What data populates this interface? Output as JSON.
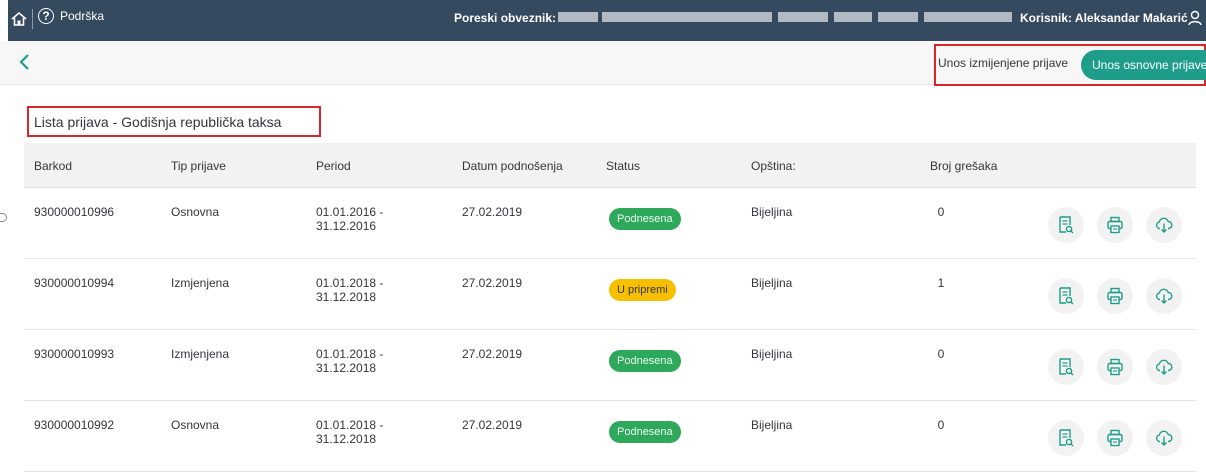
{
  "shell": {
    "help_label": "Podrška",
    "taxpayer_label": "Poreski obveznik:",
    "user_label": "Korisnik: Aleksandar Makarić"
  },
  "toolbar": {
    "amend_label": "Unos izmijenjene prijave",
    "basic_label": "Unos osnovne prijave"
  },
  "list": {
    "title": "Lista prijava - Godišnja republička taksa",
    "columns": [
      "Barkod",
      "Tip prijave",
      "Period",
      "Datum podnošenja",
      "Status",
      "Opština:",
      "Broj grešaka"
    ],
    "rows": [
      {
        "barcode": "930000010996",
        "type": "Osnovna",
        "period_from": "01.01.2016 -",
        "period_to": "31.12.2016",
        "date": "27.02.2019",
        "status": "Podnesena",
        "municipality": "Bijeljina",
        "errors": "0"
      },
      {
        "barcode": "930000010994",
        "type": "Izmjenjena",
        "period_from": "01.01.2018 -",
        "period_to": "31.12.2018",
        "date": "27.02.2019",
        "status": "U pripremi",
        "municipality": "Bijeljina",
        "errors": "1"
      },
      {
        "barcode": "930000010993",
        "type": "Izmjenjena",
        "period_from": "01.01.2018 -",
        "period_to": "31.12.2018",
        "date": "27.02.2019",
        "status": "Podnesena",
        "municipality": "Bijeljina",
        "errors": "0"
      },
      {
        "barcode": "930000010992",
        "type": "Osnovna",
        "period_from": "01.01.2018 -",
        "period_to": "31.12.2018",
        "date": "27.02.2019",
        "status": "Podnesena",
        "municipality": "Bijeljina",
        "errors": "0"
      }
    ]
  },
  "colors": {
    "shell_bg": "#354a5f",
    "accent": "#1f9d8b",
    "status_submitted": "#2ea85a",
    "status_preparing": "#f6c000",
    "highlight": "#d9262b",
    "icon_teal": "#1f9d8b"
  },
  "icons": {
    "home": "home-icon",
    "help": "help-icon",
    "user": "user-icon",
    "back": "back-chevron-icon",
    "preview": "document-preview-icon",
    "print": "printer-icon",
    "download": "cloud-download-icon"
  }
}
